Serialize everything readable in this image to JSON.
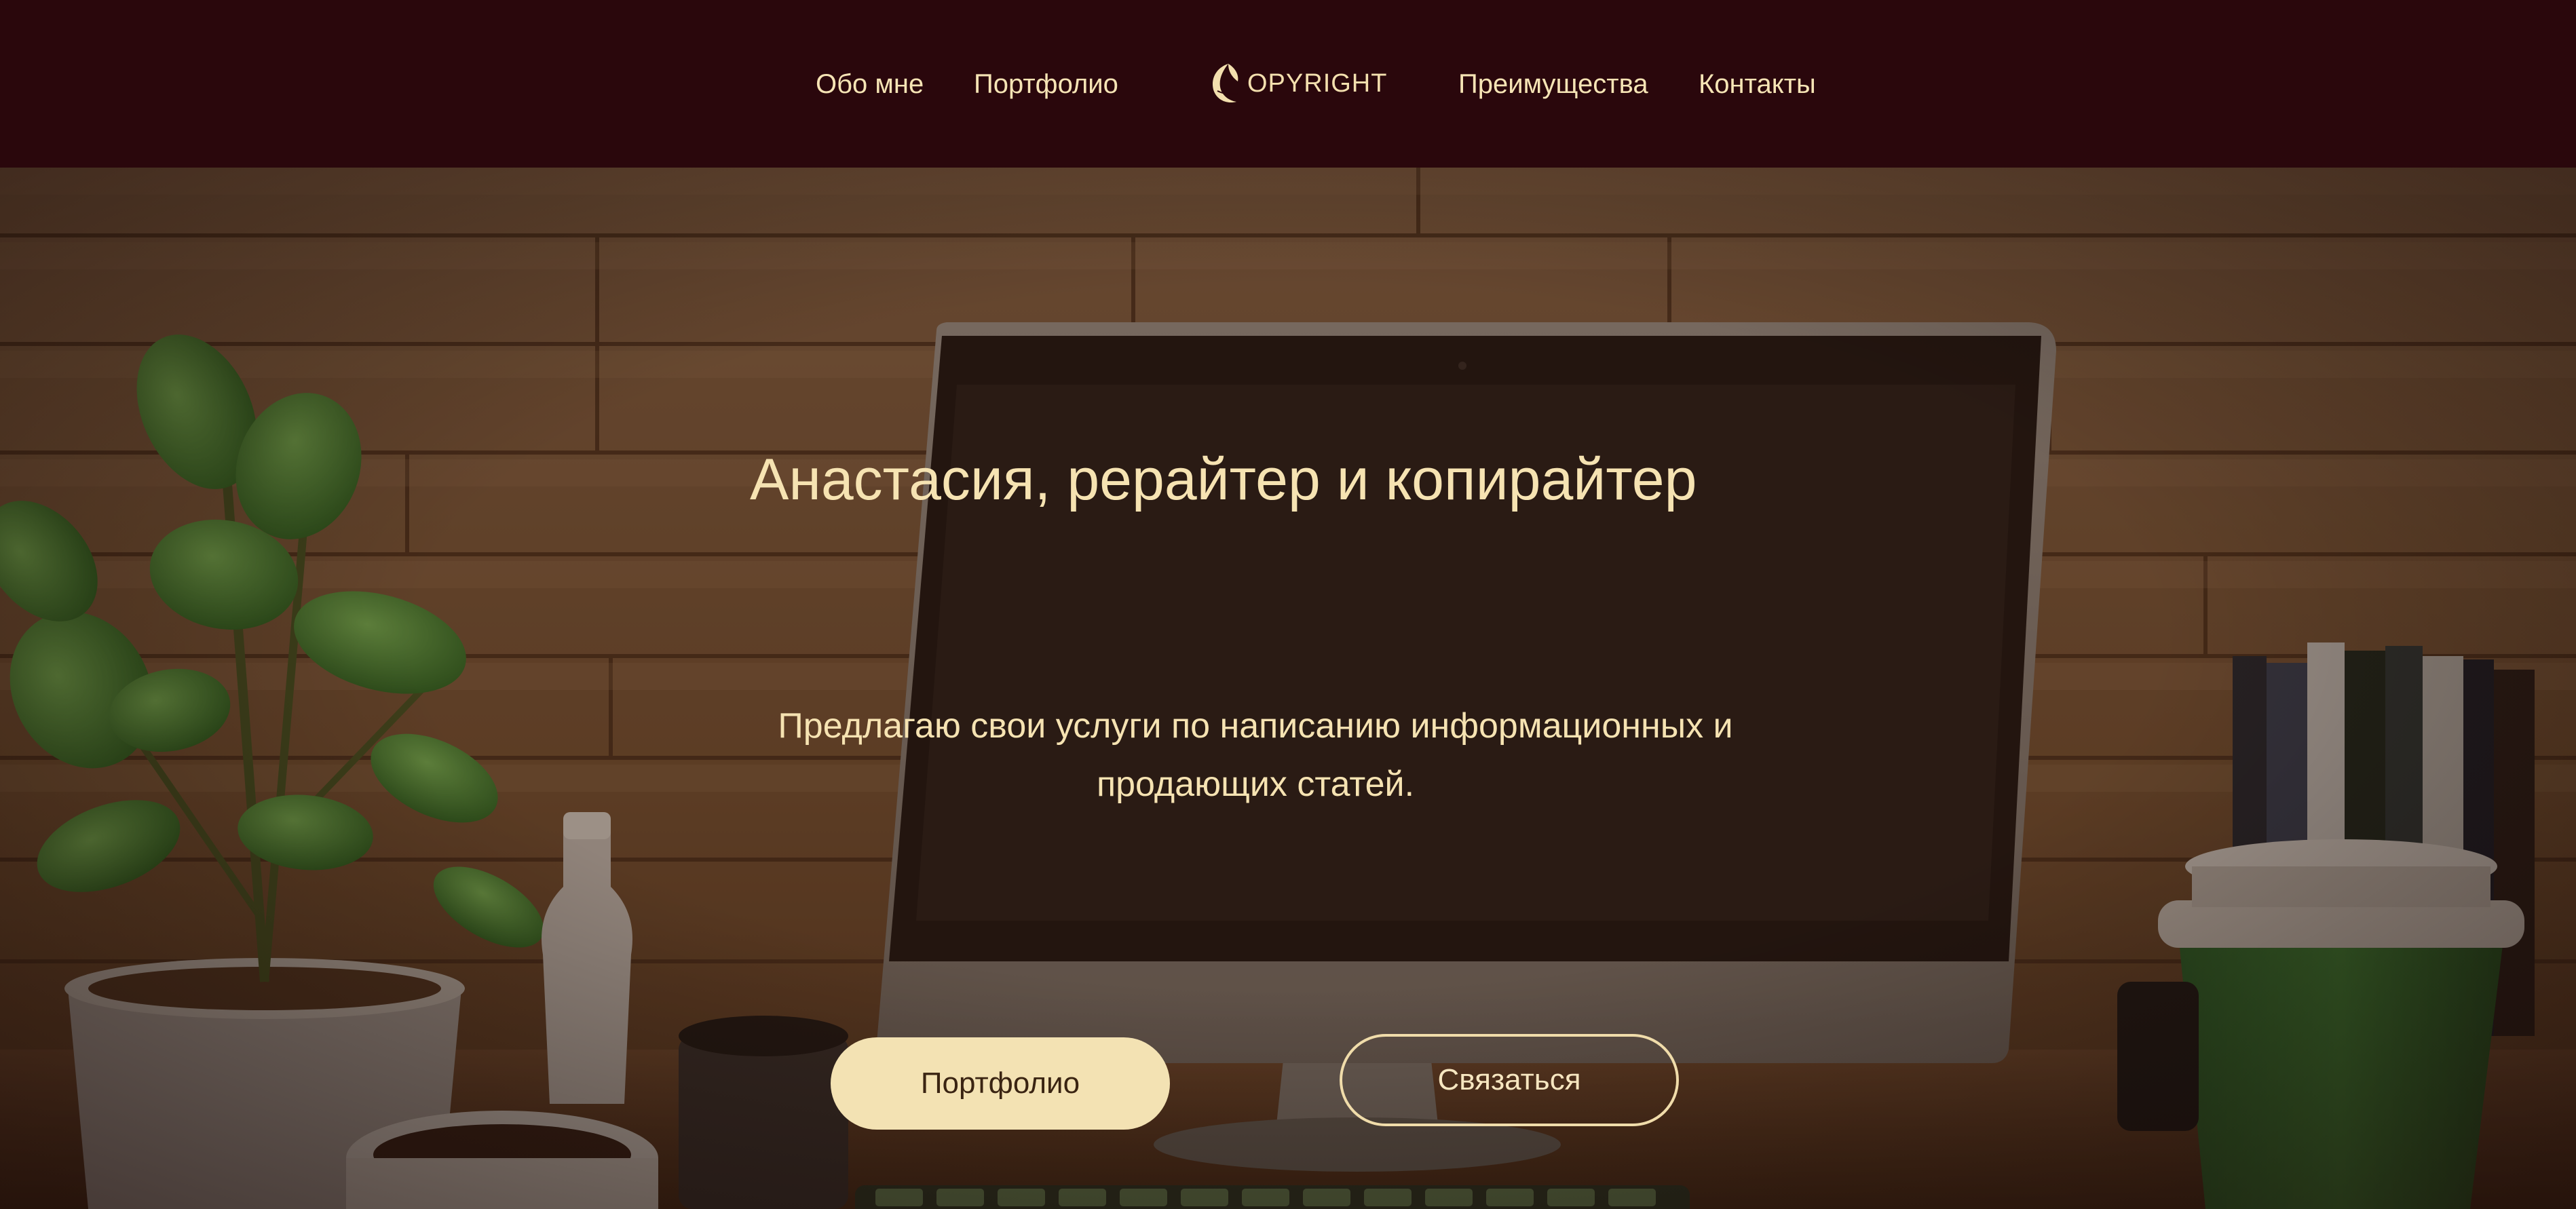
{
  "nav": {
    "left": [
      "Обо мне",
      "Портфолио"
    ],
    "right": [
      "Преимущества",
      "Контакты"
    ],
    "logo_text": "OPYRIGHT"
  },
  "hero": {
    "title": "Анастасия, рерайтер и копирайтер",
    "subtitle": "Предлагаю свои услуги по написанию информационных и продающих статей.",
    "buttons": {
      "portfolio": "Портфолио",
      "contact": "Связаться"
    }
  },
  "colors": {
    "header_bg": "#2a070c",
    "accent_cream": "#f3e2b3",
    "text_cream": "#f6e3b2"
  },
  "icons": {
    "logo": "leaf-c-logo-icon"
  }
}
